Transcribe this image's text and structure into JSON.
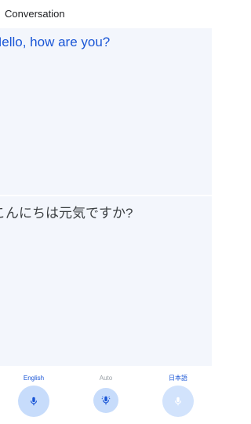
{
  "header": {
    "title": "Conversation"
  },
  "source": {
    "text": "Hello, how are you?"
  },
  "translation": {
    "text": "こんにちは元気ですか?"
  },
  "controls": {
    "left_language": "English",
    "auto_label": "Auto",
    "right_language": "日本語"
  },
  "icons": {
    "left_mic": "microphone-icon",
    "auto_mic": "auto-microphone-icon",
    "right_mic": "microphone-icon"
  },
  "colors": {
    "accent": "#1a56d6",
    "panel_bg": "#f3f6fc",
    "mic_bg": "#c7dcfb",
    "muted": "#9aa0a6"
  }
}
